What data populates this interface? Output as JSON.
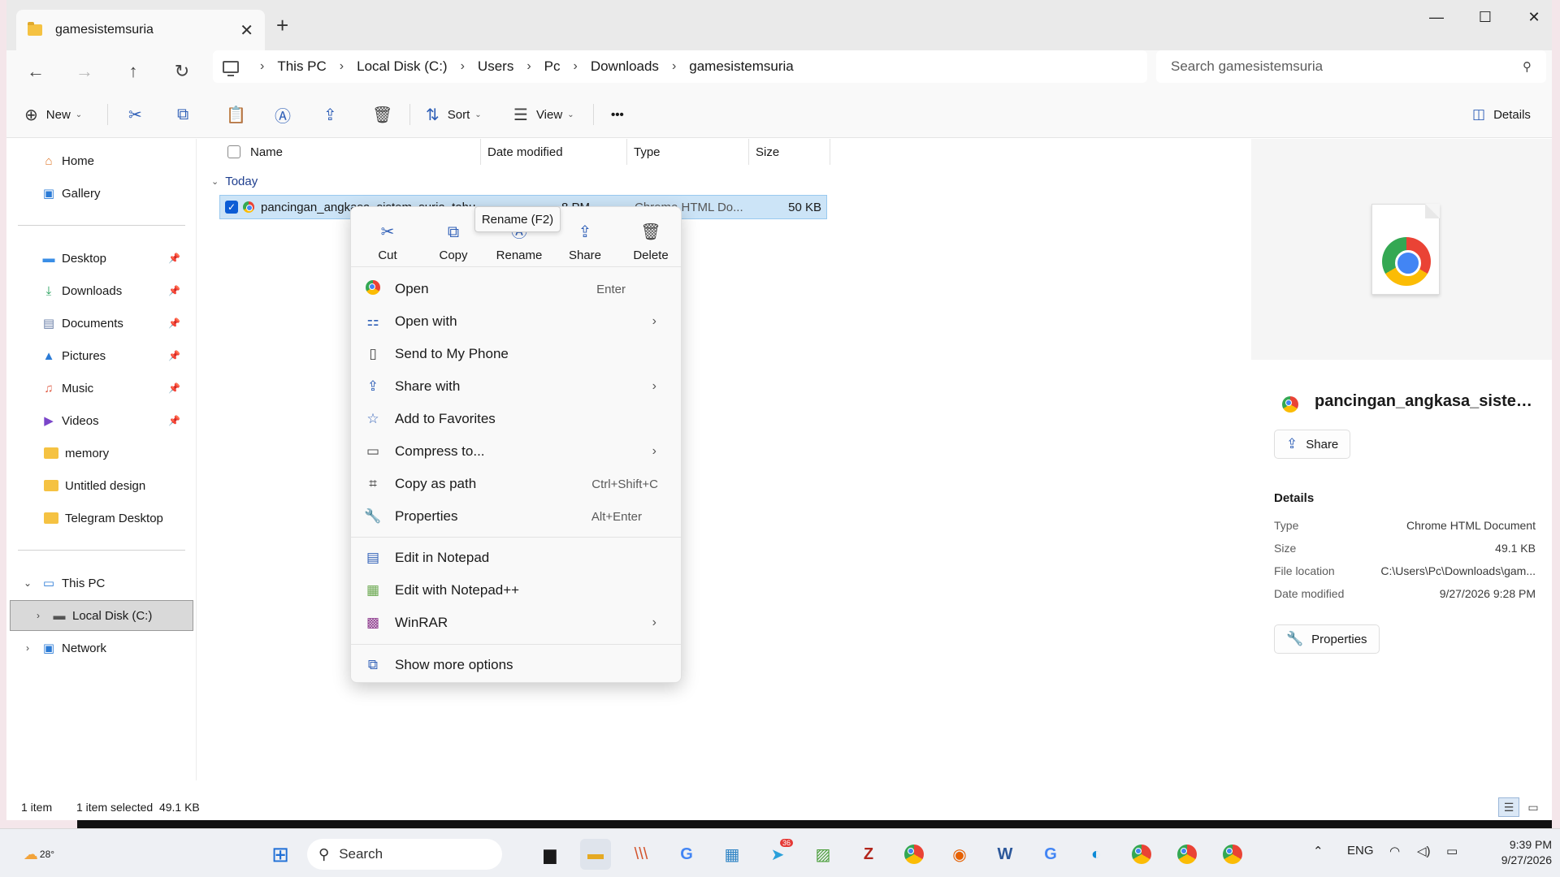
{
  "tab": {
    "title": "gamesistemsuria",
    "close": "✕",
    "new": "+"
  },
  "window_controls": {
    "minimize": "—",
    "maximize": "☐",
    "close": "✕"
  },
  "nav": {
    "back": "←",
    "forward": "→",
    "up": "↑",
    "refresh": "↻"
  },
  "breadcrumbs": [
    "This PC",
    "Local Disk (C:)",
    "Users",
    "Pc",
    "Downloads",
    "gamesistemsuria"
  ],
  "search": {
    "placeholder": "Search gamesistemsuria",
    "icon": "search-icon"
  },
  "commands": {
    "new": "New",
    "sort": "Sort",
    "view": "View",
    "more": "•••",
    "details": "Details"
  },
  "sidebar": {
    "top": [
      {
        "label": "Home",
        "icon": "home-icon"
      },
      {
        "label": "Gallery",
        "icon": "gallery-icon"
      }
    ],
    "pinned": [
      {
        "label": "Desktop",
        "icon": "desktop-icon",
        "color": "#3a8ee6"
      },
      {
        "label": "Downloads",
        "icon": "download-icon",
        "color": "#1f9e58"
      },
      {
        "label": "Documents",
        "icon": "documents-icon",
        "color": "#6a7fa8"
      },
      {
        "label": "Pictures",
        "icon": "pictures-icon",
        "color": "#2b7bd6"
      },
      {
        "label": "Music",
        "icon": "music-icon",
        "color": "#e0604a"
      },
      {
        "label": "Videos",
        "icon": "videos-icon",
        "color": "#7a45c9"
      }
    ],
    "folders": [
      "memory",
      "Untitled design",
      "Telegram Desktop"
    ],
    "tree": [
      {
        "label": "This PC",
        "icon": "this-pc-icon"
      },
      {
        "label": "Local Disk (C:)",
        "icon": "drive-icon"
      },
      {
        "label": "Network",
        "icon": "network-icon"
      }
    ]
  },
  "columns": {
    "name": "Name",
    "date": "Date modified",
    "type": "Type",
    "size": "Size"
  },
  "group": {
    "label": "Today"
  },
  "file": {
    "name": "pancingan_angkasa_sistem_suria_tahu",
    "date_frag": "8 PM",
    "type_frag": "Chrome HTML Do...",
    "size": "50 KB"
  },
  "context_menu": {
    "quick": [
      "Cut",
      "Copy",
      "Rename",
      "Share",
      "Delete"
    ],
    "items1": [
      {
        "label": "Open",
        "shortcut": "Enter",
        "icon": "chrome-icon"
      },
      {
        "label": "Open with",
        "shortcut": "",
        "icon": "open-with-icon",
        "submenu": true
      },
      {
        "label": "Send to My Phone",
        "shortcut": "",
        "icon": "phone-icon"
      },
      {
        "label": "Share with",
        "shortcut": "",
        "icon": "share-icon",
        "submenu": true
      },
      {
        "label": "Add to Favorites",
        "shortcut": "",
        "icon": "star-icon"
      },
      {
        "label": "Compress to...",
        "shortcut": "",
        "icon": "compress-icon",
        "submenu": true
      },
      {
        "label": "Copy as path",
        "shortcut": "Ctrl+Shift+C",
        "icon": "copy-path-icon"
      },
      {
        "label": "Properties",
        "shortcut": "Alt+Enter",
        "icon": "wrench-icon"
      }
    ],
    "items2": [
      {
        "label": "Edit in Notepad",
        "icon": "notepad-icon"
      },
      {
        "label": "Edit with Notepad++",
        "icon": "notepadpp-icon"
      },
      {
        "label": "WinRAR",
        "icon": "winrar-icon",
        "submenu": true
      }
    ],
    "items3": [
      {
        "label": "Show more options",
        "icon": "more-options-icon"
      }
    ]
  },
  "tooltip": "Rename (F2)",
  "details": {
    "title": "pancingan_angkasa_sistem_...",
    "share": "Share",
    "heading": "Details",
    "rows": [
      {
        "k": "Type",
        "v": "Chrome HTML Document"
      },
      {
        "k": "Size",
        "v": "49.1 KB"
      },
      {
        "k": "File location",
        "v": "C:\\Users\\Pc\\Downloads\\gam..."
      },
      {
        "k": "Date modified",
        "v": "9/27/2026 9:28 PM"
      }
    ],
    "properties": "Properties"
  },
  "status": {
    "count": "1 item",
    "selected": "1 item selected  49.1 KB"
  },
  "taskbar": {
    "weather": "28°",
    "search": "Search",
    "badge": "36",
    "tray": {
      "lang": "ENG",
      "time": "9:39 PM",
      "date": "9/27/2026"
    }
  }
}
